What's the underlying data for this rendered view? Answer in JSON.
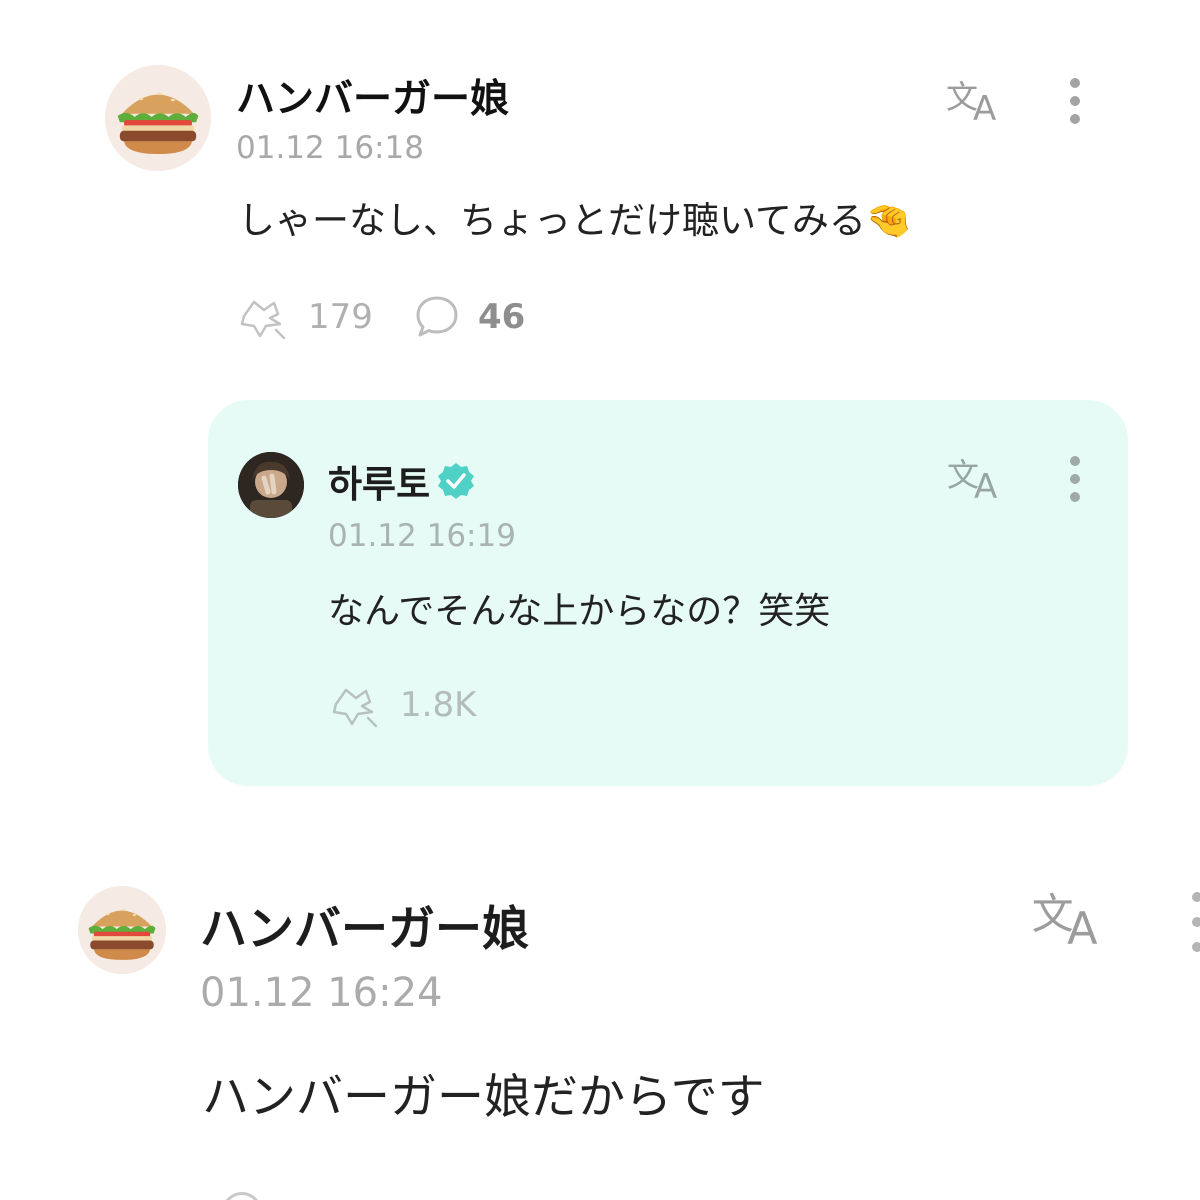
{
  "posts": [
    {
      "author": "ハンバーガー娘",
      "time": "01.12 16:18",
      "text": "しゃーなし、ちょっとだけ聴いてみる🤏",
      "likes": "179",
      "comments": "46",
      "avatar_icon": "hamburger-avatar"
    },
    {
      "author": "ハンバーガー娘",
      "time": "01.12 16:24",
      "text": "ハンバーガー娘だからです",
      "avatar_icon": "hamburger-avatar"
    }
  ],
  "reply": {
    "author": "하루토",
    "verified": true,
    "time": "01.12 16:19",
    "text": "なんでそんな上からなの？笑笑",
    "likes": "1.8K",
    "background": "#e7fbf6"
  },
  "icons": {
    "translate": "translate-icon",
    "more": "more-vertical-icon",
    "like": "like-heart-icon",
    "comment": "comment-bubble-icon",
    "verified": "verified-badge-icon"
  },
  "colors": {
    "reply_bg": "#e7fbf6",
    "verified": "#4fd1c5",
    "meta_text": "#a8a8a8"
  }
}
